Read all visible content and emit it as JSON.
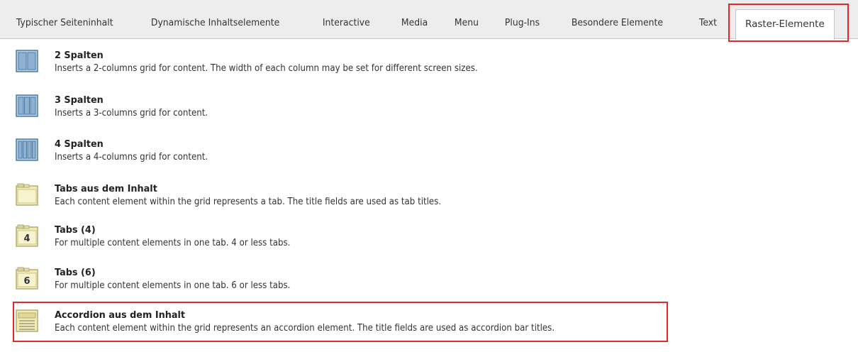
{
  "tabs": [
    {
      "label": "Typischer Seiteninhalt"
    },
    {
      "label": "Dynamische Inhaltselemente"
    },
    {
      "label": "Interactive"
    },
    {
      "label": "Media"
    },
    {
      "label": "Menu"
    },
    {
      "label": "Plug-Ins"
    },
    {
      "label": "Besondere Elemente"
    },
    {
      "label": "Text"
    },
    {
      "label": "Raster-Elemente"
    }
  ],
  "active_tab": "Raster-Elemente",
  "items": [
    {
      "icon": "two-columns-icon",
      "title": "2 Spalten",
      "description": "Inserts a 2-columns grid for content. The width of each column may be set for different screen sizes."
    },
    {
      "icon": "three-columns-icon",
      "title": "3 Spalten",
      "description": "Inserts a 3-columns grid for content."
    },
    {
      "icon": "four-columns-icon",
      "title": "4 Spalten",
      "description": "Inserts a 4-columns grid for content."
    },
    {
      "icon": "tab-folder-icon",
      "title": "Tabs aus dem Inhalt",
      "description": "Each content element within the grid represents a tab. The title fields are used as tab titles."
    },
    {
      "icon": "tab-folder-4-icon",
      "icon_label": "4",
      "title": "Tabs (4)",
      "description": "For multiple content elements in one tab. 4 or less tabs."
    },
    {
      "icon": "tab-folder-6-icon",
      "icon_label": "6",
      "title": "Tabs (6)",
      "description": "For multiple content elements in one tab. 6 or less tabs."
    },
    {
      "icon": "accordion-icon",
      "title": "Accordion aus dem Inhalt",
      "description": "Each content element within the grid represents an accordion element. The title fields are used as accordion bar titles."
    }
  ],
  "colors": {
    "highlight": "#e02a2a",
    "column_icon": "#4f7ba6",
    "tab_icon": "#f2ecb0"
  }
}
